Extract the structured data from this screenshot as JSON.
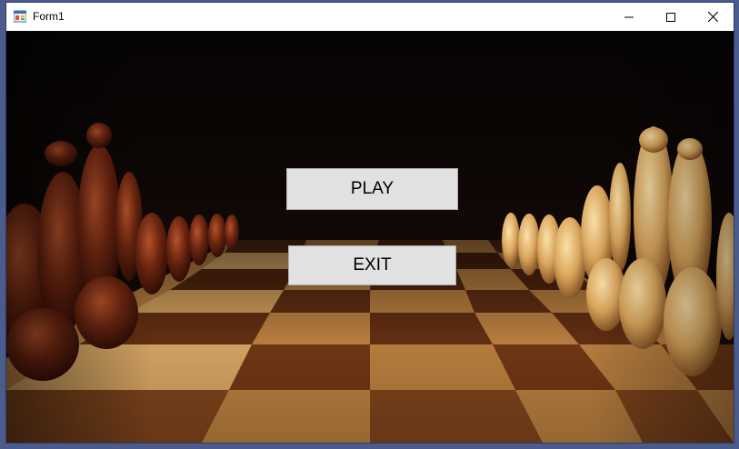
{
  "window": {
    "title": "Form1",
    "app_icon": "winforms-app-icon",
    "controls": [
      "minimize-icon",
      "maximize-icon",
      "close-icon"
    ]
  },
  "background": {
    "description_icon": "chessboard-background-image"
  },
  "buttons": {
    "play_label": "PLAY",
    "exit_label": "EXIT"
  },
  "colors": {
    "button_face": "#e1e1e1",
    "titlebar": "#ffffff",
    "frame": "#4a5b8c"
  }
}
